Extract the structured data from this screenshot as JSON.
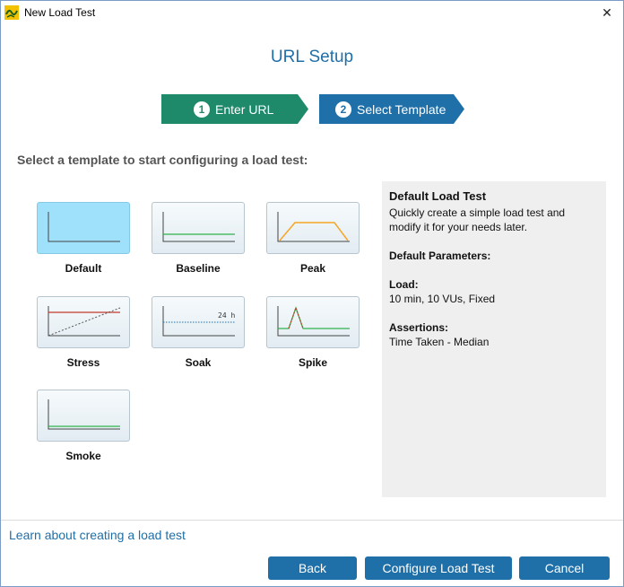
{
  "window": {
    "title": "New Load Test",
    "close_glyph": "✕"
  },
  "header": {
    "title": "URL Setup"
  },
  "steps": [
    {
      "number": "1",
      "label": "Enter URL",
      "color": "#1f8a6a"
    },
    {
      "number": "2",
      "label": "Select Template",
      "color": "#1f6fa8"
    }
  ],
  "instruction": "Select a template to start configuring a load test:",
  "templates": [
    {
      "label": "Default",
      "selected": true
    },
    {
      "label": "Baseline"
    },
    {
      "label": "Peak"
    },
    {
      "label": "Stress"
    },
    {
      "label": "Soak",
      "annotation": "24 h"
    },
    {
      "label": "Spike"
    },
    {
      "label": "Smoke"
    }
  ],
  "details": {
    "title": "Default Load Test",
    "description_line1": "Quickly create a simple load test and",
    "description_line2": "modify it for your needs later.",
    "params_heading": "Default Parameters:",
    "load_heading": "Load:",
    "load_value": "10 min, 10 VUs, Fixed",
    "assertions_heading": "Assertions:",
    "assertions_value": "Time Taken - Median"
  },
  "footer": {
    "learn_link": "Learn about creating a load test",
    "back_label": "Back",
    "configure_label": "Configure Load Test",
    "cancel_label": "Cancel"
  },
  "colors": {
    "accent_blue": "#1f6fa8",
    "accent_green": "#1f8a6a",
    "selected_tile": "#9fe1fb",
    "line_green": "#2fb34a",
    "line_orange": "#f5a623",
    "line_red": "#c0392b"
  }
}
